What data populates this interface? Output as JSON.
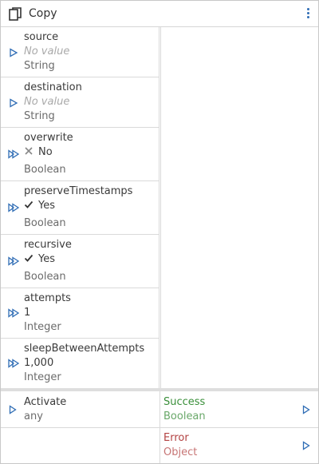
{
  "header": {
    "title": "Copy",
    "icon": "copy-documents-icon",
    "menu_icon": "more-vertical-icon"
  },
  "colors": {
    "accent": "#2f6db5",
    "success": "#3a8f3a",
    "error": "#b34242"
  },
  "params": [
    {
      "name": "source",
      "value": "No value",
      "value_empty": true,
      "type": "String",
      "arrow": "single"
    },
    {
      "name": "destination",
      "value": "No value",
      "value_empty": true,
      "type": "String",
      "arrow": "single"
    },
    {
      "name": "overwrite",
      "value": "No",
      "icon": "cross-icon",
      "type": "Boolean",
      "arrow": "double"
    },
    {
      "name": "preserveTimestamps",
      "value": "Yes",
      "icon": "check-icon",
      "type": "Boolean",
      "arrow": "double"
    },
    {
      "name": "recursive",
      "value": "Yes",
      "icon": "check-icon",
      "type": "Boolean",
      "arrow": "double"
    },
    {
      "name": "attempts",
      "value": "1",
      "type": "Integer",
      "arrow": "double"
    },
    {
      "name": "sleepBetweenAttempts",
      "value": "1,000",
      "type": "Integer",
      "arrow": "double"
    }
  ],
  "activate": {
    "name": "Activate",
    "type": "any"
  },
  "outputs": [
    {
      "name": "Success",
      "type": "Boolean"
    },
    {
      "name": "Error",
      "type": "Object"
    }
  ]
}
